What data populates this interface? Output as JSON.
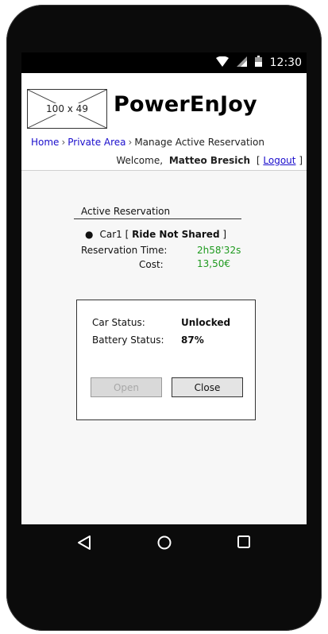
{
  "status_bar": {
    "time": "12:30",
    "icons": [
      "wifi-icon",
      "signal-icon",
      "battery-icon"
    ]
  },
  "header": {
    "logo_placeholder": "100 x 49",
    "app_title": "PowerEnJoy",
    "breadcrumb": {
      "home": "Home",
      "private_area": "Private Area",
      "current": "Manage Active Reservation",
      "separator": "›"
    },
    "welcome": {
      "prefix": "Welcome,",
      "user": "Matteo Bresich",
      "open_bracket": "[",
      "logout": "Logout",
      "close_bracket": "]"
    }
  },
  "reservation": {
    "section_title": "Active Reservation",
    "car": "Car1",
    "open_bracket": "[",
    "ride_type": "Ride Not Shared",
    "close_bracket": "]",
    "time_label": "Reservation Time:",
    "time_value": "2h58'32s",
    "cost_label": "Cost:",
    "cost_value": "13,50€"
  },
  "car_dialog": {
    "car_status_label": "Car Status:",
    "car_status_value": "Unlocked",
    "battery_label": "Battery Status:",
    "battery_value": "87%",
    "open_button": "Open",
    "close_button": "Close"
  },
  "navigation": {
    "icons": [
      "back-icon",
      "home-icon",
      "recents-icon"
    ]
  },
  "colors": {
    "link": "#1a0dcc",
    "value_green": "#1f9a1f",
    "disabled_text": "#a8a8a8"
  }
}
